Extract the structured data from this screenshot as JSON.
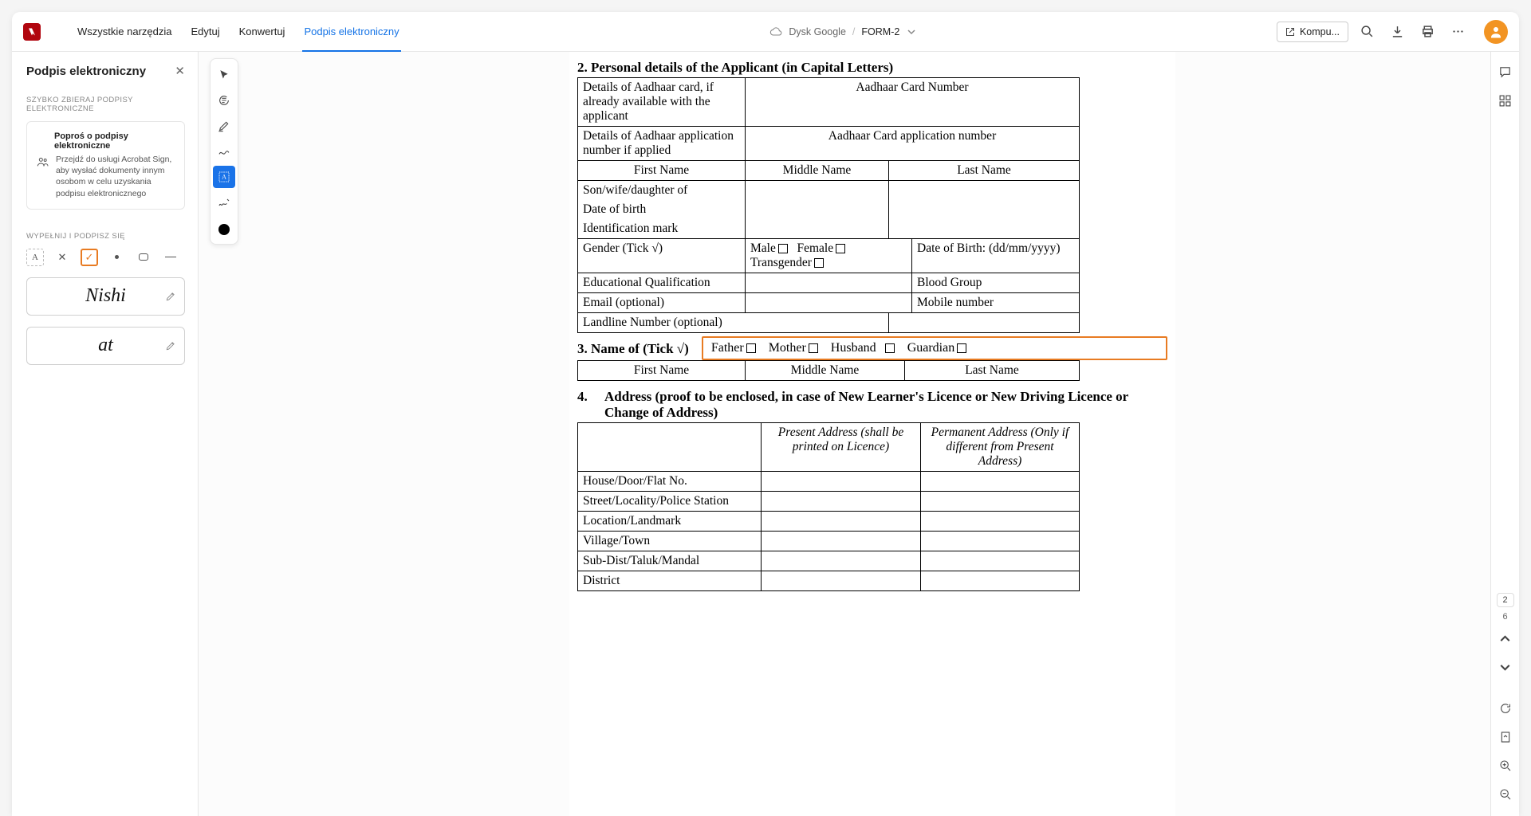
{
  "header": {
    "tabs": [
      "Wszystkie narzędzia",
      "Edytuj",
      "Konwertuj",
      "Podpis elektroniczny"
    ],
    "active_tab": 3,
    "breadcrumb_source": "Dysk Google",
    "breadcrumb_doc": "FORM-2",
    "computer_button": "Kompu..."
  },
  "sidebar": {
    "title": "Podpis elektroniczny",
    "section1_label": "SZYBKO ZBIERAJ PODPISY ELEKTRONICZNE",
    "card_title": "Poproś o podpisy elektroniczne",
    "card_desc": "Przejdź do usługi Acrobat Sign, aby wysłać dokumenty innym osobom w celu uzyskania podpisu elektronicznego",
    "section2_label": "WYPEŁNIJ I PODPISZ SIĘ",
    "signature1": "Nishi",
    "signature2": "at"
  },
  "document": {
    "s2_title": "2.      Personal details of the Applicant (in Capital Letters)",
    "r_aadhaar_avail": "Details of Aadhaar card, if already available with the applicant",
    "r_aadhaar_num": "Aadhaar Card Number",
    "r_aadhaar_applied": "Details of Aadhaar application number if applied",
    "r_aadhaar_appnum": "Aadhaar Card application number",
    "first_name": "First Name",
    "middle_name": "Middle Name",
    "last_name": "Last Name",
    "son_wife": "Son/wife/daughter of",
    "dob": "Date of birth",
    "idmark": "Identification mark",
    "gender_label": "Gender (Tick √)",
    "g_male": "Male",
    "g_female": "Female",
    "g_trans": "Transgender",
    "dob2": "Date of Birth: (dd/mm/yyyy)",
    "edu": "Educational Qualification",
    "blood": "Blood Group",
    "email": "Email (optional)",
    "mobile": "Mobile number",
    "landline": "Landline Number (optional)",
    "s3_title": "3.      Name of (Tick √)",
    "rel_father": "Father",
    "rel_mother": "Mother",
    "rel_husband": "Husband",
    "rel_guardian": "Guardian",
    "s4_title": "4.      Address (proof to be enclosed, in case of New Learner's Licence or New Driving Licence or Change of Address)",
    "present_addr": "Present Address (shall be printed on Licence)",
    "perm_addr": "Permanent Address (Only if different from Present Address)",
    "addr_rows": [
      "House/Door/Flat No.",
      "Street/Locality/Police Station",
      "Location/Landmark",
      "Village/Town",
      "Sub-Dist/Taluk/Mandal",
      "District"
    ]
  },
  "rail": {
    "current_page": "2",
    "total_pages": "6"
  }
}
